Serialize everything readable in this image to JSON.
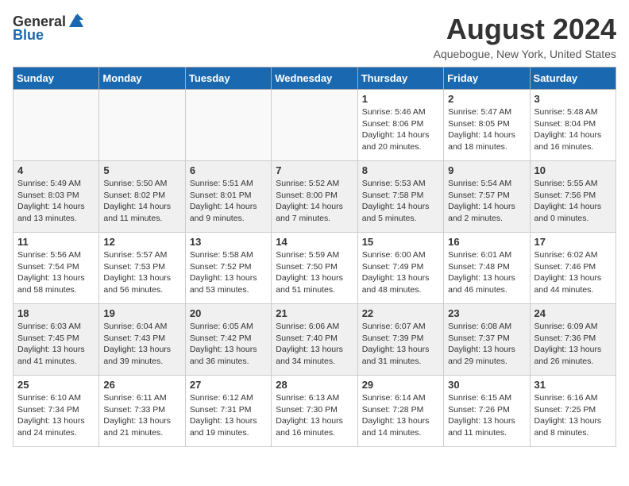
{
  "header": {
    "logo_general": "General",
    "logo_blue": "Blue",
    "month_year": "August 2024",
    "location": "Aquebogue, New York, United States"
  },
  "days_of_week": [
    "Sunday",
    "Monday",
    "Tuesday",
    "Wednesday",
    "Thursday",
    "Friday",
    "Saturday"
  ],
  "weeks": [
    [
      {
        "day": "",
        "info": ""
      },
      {
        "day": "",
        "info": ""
      },
      {
        "day": "",
        "info": ""
      },
      {
        "day": "",
        "info": ""
      },
      {
        "day": "1",
        "info": "Sunrise: 5:46 AM\nSunset: 8:06 PM\nDaylight: 14 hours\nand 20 minutes."
      },
      {
        "day": "2",
        "info": "Sunrise: 5:47 AM\nSunset: 8:05 PM\nDaylight: 14 hours\nand 18 minutes."
      },
      {
        "day": "3",
        "info": "Sunrise: 5:48 AM\nSunset: 8:04 PM\nDaylight: 14 hours\nand 16 minutes."
      }
    ],
    [
      {
        "day": "4",
        "info": "Sunrise: 5:49 AM\nSunset: 8:03 PM\nDaylight: 14 hours\nand 13 minutes."
      },
      {
        "day": "5",
        "info": "Sunrise: 5:50 AM\nSunset: 8:02 PM\nDaylight: 14 hours\nand 11 minutes."
      },
      {
        "day": "6",
        "info": "Sunrise: 5:51 AM\nSunset: 8:01 PM\nDaylight: 14 hours\nand 9 minutes."
      },
      {
        "day": "7",
        "info": "Sunrise: 5:52 AM\nSunset: 8:00 PM\nDaylight: 14 hours\nand 7 minutes."
      },
      {
        "day": "8",
        "info": "Sunrise: 5:53 AM\nSunset: 7:58 PM\nDaylight: 14 hours\nand 5 minutes."
      },
      {
        "day": "9",
        "info": "Sunrise: 5:54 AM\nSunset: 7:57 PM\nDaylight: 14 hours\nand 2 minutes."
      },
      {
        "day": "10",
        "info": "Sunrise: 5:55 AM\nSunset: 7:56 PM\nDaylight: 14 hours\nand 0 minutes."
      }
    ],
    [
      {
        "day": "11",
        "info": "Sunrise: 5:56 AM\nSunset: 7:54 PM\nDaylight: 13 hours\nand 58 minutes."
      },
      {
        "day": "12",
        "info": "Sunrise: 5:57 AM\nSunset: 7:53 PM\nDaylight: 13 hours\nand 56 minutes."
      },
      {
        "day": "13",
        "info": "Sunrise: 5:58 AM\nSunset: 7:52 PM\nDaylight: 13 hours\nand 53 minutes."
      },
      {
        "day": "14",
        "info": "Sunrise: 5:59 AM\nSunset: 7:50 PM\nDaylight: 13 hours\nand 51 minutes."
      },
      {
        "day": "15",
        "info": "Sunrise: 6:00 AM\nSunset: 7:49 PM\nDaylight: 13 hours\nand 48 minutes."
      },
      {
        "day": "16",
        "info": "Sunrise: 6:01 AM\nSunset: 7:48 PM\nDaylight: 13 hours\nand 46 minutes."
      },
      {
        "day": "17",
        "info": "Sunrise: 6:02 AM\nSunset: 7:46 PM\nDaylight: 13 hours\nand 44 minutes."
      }
    ],
    [
      {
        "day": "18",
        "info": "Sunrise: 6:03 AM\nSunset: 7:45 PM\nDaylight: 13 hours\nand 41 minutes."
      },
      {
        "day": "19",
        "info": "Sunrise: 6:04 AM\nSunset: 7:43 PM\nDaylight: 13 hours\nand 39 minutes."
      },
      {
        "day": "20",
        "info": "Sunrise: 6:05 AM\nSunset: 7:42 PM\nDaylight: 13 hours\nand 36 minutes."
      },
      {
        "day": "21",
        "info": "Sunrise: 6:06 AM\nSunset: 7:40 PM\nDaylight: 13 hours\nand 34 minutes."
      },
      {
        "day": "22",
        "info": "Sunrise: 6:07 AM\nSunset: 7:39 PM\nDaylight: 13 hours\nand 31 minutes."
      },
      {
        "day": "23",
        "info": "Sunrise: 6:08 AM\nSunset: 7:37 PM\nDaylight: 13 hours\nand 29 minutes."
      },
      {
        "day": "24",
        "info": "Sunrise: 6:09 AM\nSunset: 7:36 PM\nDaylight: 13 hours\nand 26 minutes."
      }
    ],
    [
      {
        "day": "25",
        "info": "Sunrise: 6:10 AM\nSunset: 7:34 PM\nDaylight: 13 hours\nand 24 minutes."
      },
      {
        "day": "26",
        "info": "Sunrise: 6:11 AM\nSunset: 7:33 PM\nDaylight: 13 hours\nand 21 minutes."
      },
      {
        "day": "27",
        "info": "Sunrise: 6:12 AM\nSunset: 7:31 PM\nDaylight: 13 hours\nand 19 minutes."
      },
      {
        "day": "28",
        "info": "Sunrise: 6:13 AM\nSunset: 7:30 PM\nDaylight: 13 hours\nand 16 minutes."
      },
      {
        "day": "29",
        "info": "Sunrise: 6:14 AM\nSunset: 7:28 PM\nDaylight: 13 hours\nand 14 minutes."
      },
      {
        "day": "30",
        "info": "Sunrise: 6:15 AM\nSunset: 7:26 PM\nDaylight: 13 hours\nand 11 minutes."
      },
      {
        "day": "31",
        "info": "Sunrise: 6:16 AM\nSunset: 7:25 PM\nDaylight: 13 hours\nand 8 minutes."
      }
    ]
  ]
}
